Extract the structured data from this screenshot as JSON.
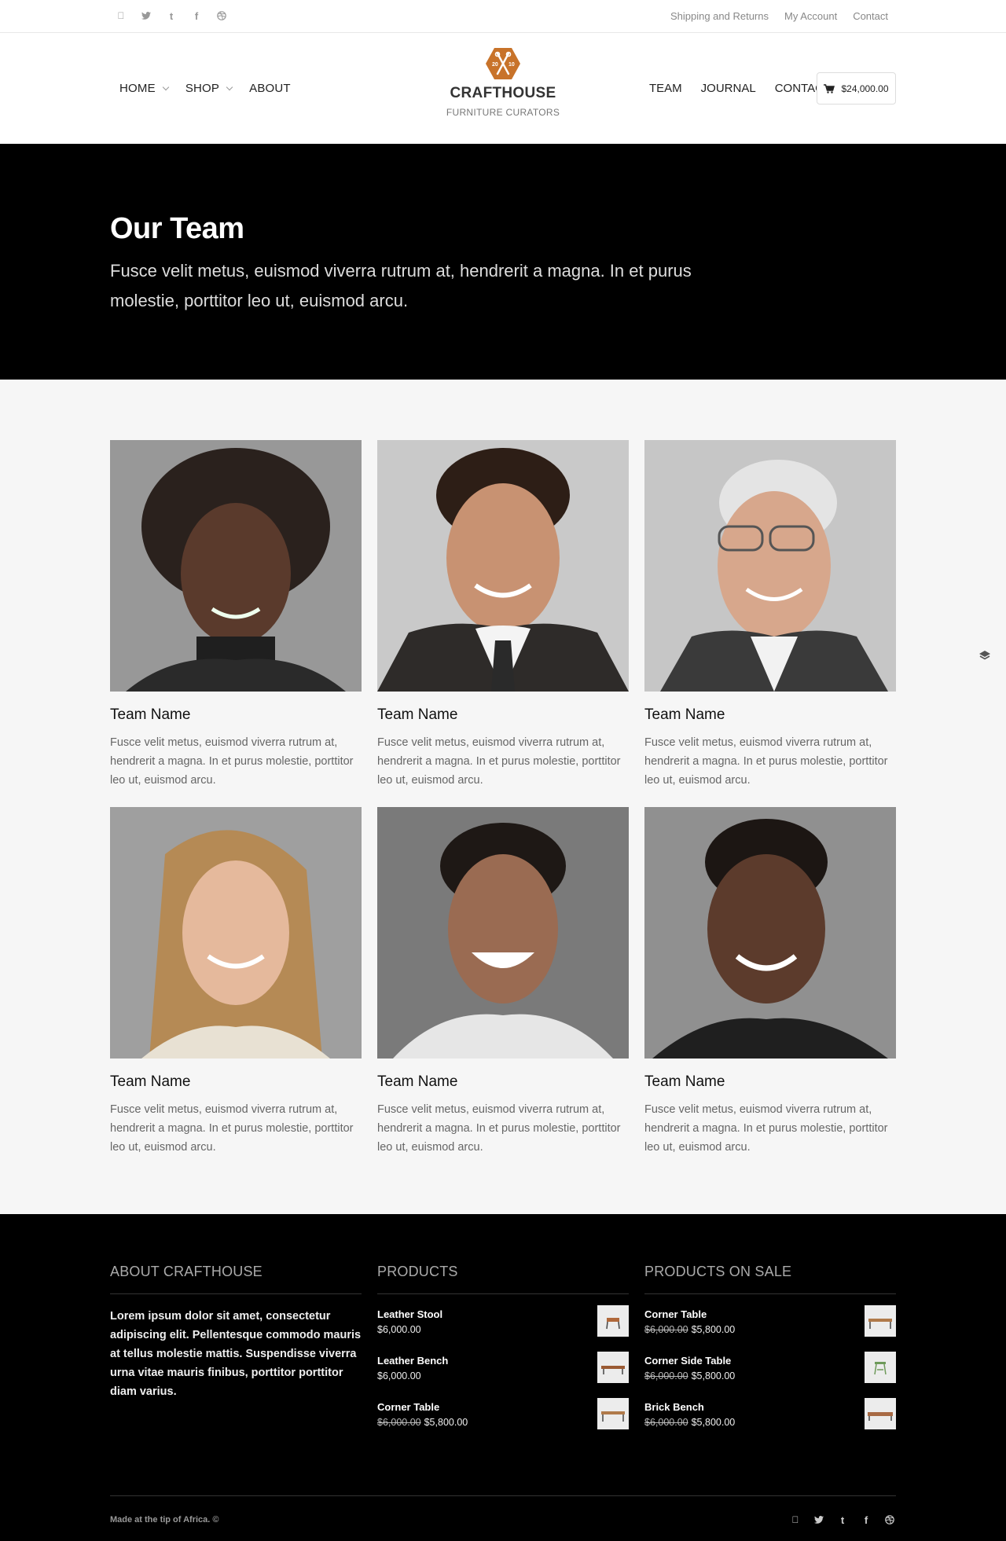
{
  "topbar": {
    "social_icons": [
      "apple-icon",
      "twitter-icon",
      "tumblr-icon",
      "facebook-icon",
      "dribbble-icon"
    ],
    "links": [
      "Shipping and Returns",
      "My Account",
      "Contact"
    ]
  },
  "header": {
    "nav_left": [
      {
        "label": "HOME",
        "dropdown": true
      },
      {
        "label": "SHOP",
        "dropdown": true
      },
      {
        "label": "ABOUT",
        "dropdown": false
      }
    ],
    "logo": {
      "badge_left": "20",
      "badge_right": "10",
      "brand": "CRAFTHOUSE",
      "tagline": "FURNITURE CURATORS"
    },
    "nav_right": [
      "TEAM",
      "JOURNAL",
      "CONTACT"
    ],
    "cart": {
      "total": "$24,000.00"
    }
  },
  "hero": {
    "title": "Our Team",
    "subtitle": "Fusce velit metus, euismod viverra rutrum at, hendrerit a magna. In et purus molestie, porttitor leo ut, euismod arcu."
  },
  "team": [
    {
      "name": "Team Name",
      "bio": "Fusce velit metus, euismod viverra rutrum at, hendrerit a magna. In et purus molestie, porttitor leo ut, euismod arcu."
    },
    {
      "name": "Team Name",
      "bio": "Fusce velit metus, euismod viverra rutrum at, hendrerit a magna. In et purus molestie, porttitor leo ut, euismod arcu."
    },
    {
      "name": "Team Name",
      "bio": "Fusce velit metus, euismod viverra rutrum at, hendrerit a magna. In et purus molestie, porttitor leo ut, euismod arcu."
    },
    {
      "name": "Team Name",
      "bio": "Fusce velit metus, euismod viverra rutrum at, hendrerit a magna. In et purus molestie, porttitor leo ut, euismod arcu."
    },
    {
      "name": "Team Name",
      "bio": "Fusce velit metus, euismod viverra rutrum at, hendrerit a magna. In et purus molestie, porttitor leo ut, euismod arcu."
    },
    {
      "name": "Team Name",
      "bio": "Fusce velit metus, euismod viverra rutrum at, hendrerit a magna. In et purus molestie, porttitor leo ut, euismod arcu."
    }
  ],
  "footer": {
    "about": {
      "heading": "ABOUT CRAFTHOUSE",
      "text": "Lorem ipsum dolor sit amet, consectetur adipiscing elit. Pellentesque commodo mauris at tellus molestie mattis. Suspendisse viverra urna vitae mauris finibus, porttitor porttitor diam varius."
    },
    "products": {
      "heading": "PRODUCTS",
      "items": [
        {
          "name": "Leather Stool",
          "old_price": "",
          "price": "$6,000.00"
        },
        {
          "name": "Leather Bench",
          "old_price": "",
          "price": "$6,000.00"
        },
        {
          "name": "Corner Table",
          "old_price": "$6,000.00",
          "price": "$5,800.00"
        }
      ]
    },
    "sale": {
      "heading": "PRODUCTS ON SALE",
      "items": [
        {
          "name": "Corner Table",
          "old_price": "$6,000.00",
          "price": "$5,800.00"
        },
        {
          "name": "Corner Side Table",
          "old_price": "$6,000.00",
          "price": "$5,800.00"
        },
        {
          "name": "Brick Bench",
          "old_price": "$6,000.00",
          "price": "$5,800.00"
        }
      ]
    },
    "made": "Made at the tip of Africa. ©",
    "social_icons": [
      "apple-icon",
      "twitter-icon",
      "tumblr-icon",
      "facebook-icon",
      "dribbble-icon"
    ]
  },
  "colors": {
    "accent": "#c8732a",
    "hero_bg": "#000000",
    "footer_bg": "#000000",
    "page_bg": "#f6f6f6"
  }
}
